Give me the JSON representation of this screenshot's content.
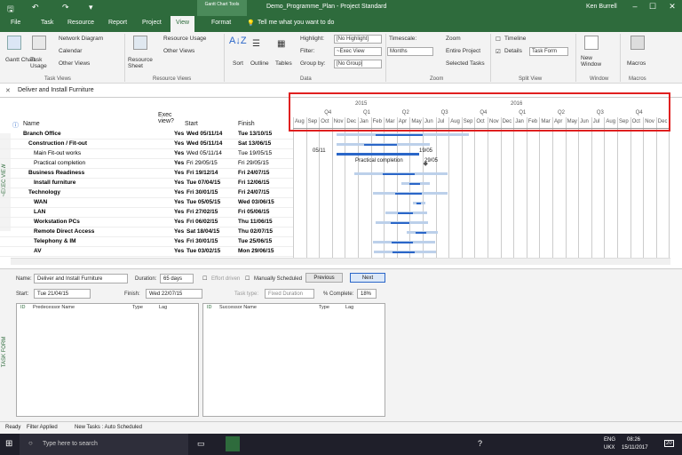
{
  "titlebar": {
    "context_tools": "Gantt Chart Tools",
    "doc_title": "Demo_Programme_Plan - Project Standard",
    "user": "Ken Burrell"
  },
  "tabs": [
    "File",
    "Task",
    "Resource",
    "Report",
    "Project",
    "View",
    "Format"
  ],
  "tell_me": "Tell me what you want to do",
  "ribbon": {
    "gantt_chart": "Gantt Chart",
    "task_usage": "Task Usage",
    "network_diagram": "Network Diagram",
    "calendar": "Calendar",
    "other_views": "Other Views",
    "task_views": "Task Views",
    "resource_sheet": "Resource Sheet",
    "resource_usage": "Resource Usage",
    "other_views2": "Other Views",
    "resource_views": "Resource Views",
    "sort": "Sort",
    "outline": "Outline",
    "tables": "Tables",
    "highlight": "Highlight:",
    "highlight_val": "[No Highlight]",
    "filter": "Filter:",
    "filter_val": "~Exec View",
    "group_by": "Group by:",
    "group_val": "[No Group]",
    "data": "Data",
    "timescale": "Timescale:",
    "timescale_val": "Months",
    "zoom": "Zoom",
    "entire_project": "Entire Project",
    "selected_tasks": "Selected Tasks",
    "zoom_grp": "Zoom",
    "timeline": "Timeline",
    "details": "Details",
    "details_val": "Task Form",
    "split_view": "Split View",
    "new_window": "New Window",
    "window": "Window",
    "macros": "Macros",
    "macros_grp": "Macros"
  },
  "entry_value": "Deliver and Install Furniture",
  "grid": {
    "headers": {
      "name": "Name",
      "exec": "Exec view?",
      "start": "Start",
      "finish": "Finish"
    },
    "rows": [
      {
        "name": "Branch Office",
        "exec": "Yes",
        "start": "Wed 05/11/14",
        "finish": "Tue 13/10/15",
        "lvl": 0,
        "bold": true
      },
      {
        "name": "Construction / Fit-out",
        "exec": "Yes",
        "start": "Wed 05/11/14",
        "finish": "Sat 13/06/15",
        "lvl": 1,
        "bold": true
      },
      {
        "name": "Main Fit-out works",
        "exec": "Yes",
        "start": "Wed 05/11/14",
        "finish": "Tue 19/05/15",
        "lvl": 2,
        "bold": false
      },
      {
        "name": "Practical completion",
        "exec": "Yes",
        "start": "Fri 29/05/15",
        "finish": "Fri 29/05/15",
        "lvl": 2,
        "bold": false
      },
      {
        "name": "Business Readiness",
        "exec": "Yes",
        "start": "Fri 19/12/14",
        "finish": "Fri 24/07/15",
        "lvl": 1,
        "bold": true
      },
      {
        "name": "Install furniture",
        "exec": "Yes",
        "start": "Tue 07/04/15",
        "finish": "Fri 12/06/15",
        "lvl": 2,
        "bold": true
      },
      {
        "name": "Technology",
        "exec": "Yes",
        "start": "Fri 30/01/15",
        "finish": "Fri 24/07/15",
        "lvl": 1,
        "bold": true
      },
      {
        "name": "WAN",
        "exec": "Yes",
        "start": "Tue 05/05/15",
        "finish": "Wed 03/06/15",
        "lvl": 2,
        "bold": true
      },
      {
        "name": "LAN",
        "exec": "Yes",
        "start": "Fri 27/02/15",
        "finish": "Fri 05/06/15",
        "lvl": 2,
        "bold": true
      },
      {
        "name": "Workstation PCs",
        "exec": "Yes",
        "start": "Fri 06/02/15",
        "finish": "Thu 11/06/15",
        "lvl": 2,
        "bold": true
      },
      {
        "name": "Remote Direct Access",
        "exec": "Yes",
        "start": "Sat 18/04/15",
        "finish": "Thu 02/07/15",
        "lvl": 2,
        "bold": true
      },
      {
        "name": "Telephony & IM",
        "exec": "Yes",
        "start": "Fri 30/01/15",
        "finish": "Tue 25/06/15",
        "lvl": 2,
        "bold": true
      },
      {
        "name": "AV",
        "exec": "Yes",
        "start": "Tue 03/02/15",
        "finish": "Mon 29/06/15",
        "lvl": 2,
        "bold": true
      }
    ]
  },
  "gantt": {
    "years": [
      "2015",
      "2016"
    ],
    "quarters": [
      "Q4",
      "Q1",
      "Q2",
      "Q3",
      "Q4",
      "Q1",
      "Q2",
      "Q3",
      "Q4"
    ],
    "months": [
      "Aug",
      "Sep",
      "Oct",
      "Nov",
      "Dec",
      "Jan",
      "Feb",
      "Mar",
      "Apr",
      "May",
      "Jun",
      "Jul",
      "Aug",
      "Sep",
      "Oct",
      "Nov",
      "Dec",
      "Jan",
      "Feb",
      "Mar",
      "Apr",
      "May",
      "Jun",
      "Jul",
      "Aug",
      "Sep",
      "Oct",
      "Nov",
      "Dec"
    ],
    "label_start": "05/11",
    "label_end": "19/05",
    "practical": "Practical completion",
    "practical_date": "29/05",
    "side_label": "~EXEC VIEW"
  },
  "form": {
    "name_lbl": "Name:",
    "name_val": "Deliver and Install Furniture",
    "duration_lbl": "Duration:",
    "duration_val": "65 days",
    "effort": "Effort driven",
    "manual": "Manually Scheduled",
    "previous": "Previous",
    "next": "Next",
    "start_lbl": "Start:",
    "start_val": "Tue 21/04/15",
    "finish_lbl": "Finish:",
    "finish_val": "Wed 22/07/15",
    "tasktype_lbl": "Task type:",
    "tasktype_val": "Fixed Duration",
    "pct_lbl": "% Complete:",
    "pct_val": "18%",
    "pred": {
      "id": "ID",
      "name": "Predecessor Name",
      "type": "Type",
      "lag": "Lag"
    },
    "succ": {
      "id": "ID",
      "name": "Successor Name",
      "type": "Type",
      "lag": "Lag"
    },
    "side": "TASK FORM"
  },
  "status": {
    "ready": "Ready",
    "filter": "Filter Applied",
    "newtasks": "New Tasks : Auto Scheduled"
  },
  "taskbar": {
    "search": "Type here to search",
    "lang": "ENG",
    "region": "UKX",
    "time": "08:26",
    "date": "15/11/2017",
    "notif": "20"
  }
}
